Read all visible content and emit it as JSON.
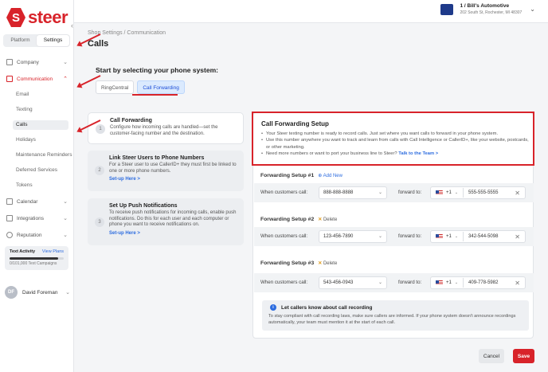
{
  "brand": {
    "name": "steer",
    "mark": "S"
  },
  "sidebar": {
    "segment": {
      "platform": "Platform",
      "settings": "Settings"
    },
    "nav": {
      "company": "Company",
      "communication": "Communication",
      "calendar": "Calendar",
      "integrations": "Integrations",
      "reputation": "Reputation"
    },
    "sub_items": {
      "email": "Email",
      "texting": "Texting",
      "calls": "Calls",
      "holidays": "Holidays",
      "maintenance": "Maintenance Reminders",
      "deferred": "Deferred Services",
      "tokens": "Tokens"
    },
    "text_activity": {
      "title": "Text Activity",
      "link": "View Plans",
      "caption": "0/101,000 Text Campaigns",
      "progress": 0.9
    },
    "user": {
      "initials": "DF",
      "name": "David Foreman"
    }
  },
  "header": {
    "account_title": "1 / Bill's Automotive",
    "account_address": "202 South St, Rochester, MI 48307"
  },
  "breadcrumb": "Shop Settings / Communication",
  "page_title": "Calls",
  "system": {
    "title": "Start by selecting your phone system:",
    "tabs": [
      "RingCentral",
      "Call Forwarding"
    ]
  },
  "steps": [
    {
      "num": "1",
      "title": "Call Forwarding",
      "desc": "Configure how incoming calls are handled—set the customer-facing number and the destination.",
      "link": ""
    },
    {
      "num": "2",
      "title": "Link Steer Users to Phone Numbers",
      "desc": "For a Steer user to use CallerID+ they must first be linked to one or more phone numbers.",
      "link": "Set-up Here >"
    },
    {
      "num": "3",
      "title": "Set Up Push Notifications",
      "desc": "To receive push notifications for incoming calls, enable push notifications. Do this for each user and each computer or phone you want to receive notifications on.",
      "link": "Set-up Here >"
    }
  ],
  "cf": {
    "title": "Call Forwarding Setup",
    "bullets": [
      "Your Steer texting number is ready to record calls. Just set where you want calls to forward in your phone system.",
      "Use this number anywhere you want to track and learn from calls with Call Intelligence or CallerID+, like your website, postcards, or other marketing."
    ],
    "bullet3_text": "Need more numbers or want to port your business line to Steer?",
    "bullet3_link": "Talk to the Team >",
    "when_label": "When customers call:",
    "forward_label": "forward to:",
    "country_code": "+1",
    "setups": [
      {
        "title": "Forwarding Setup #1",
        "action": "Add New",
        "from": "888-888-8888",
        "to": "555-555-5555"
      },
      {
        "title": "Forwarding Setup #2",
        "action": "Delete",
        "from": "123-456-7890",
        "to": "342-544-5098"
      },
      {
        "title": "Forwarding Setup #3",
        "action": "Delete",
        "from": "543-456-0943",
        "to": "409-778-5982"
      }
    ],
    "notice_title": "Let callers know about call recording",
    "notice_desc": "To stay compliant with call recording laws, make sure callers are informed. If your phone system doesn't announce recordings automatically, your team must mention it at the start of each call."
  },
  "buttons": {
    "cancel": "Cancel",
    "save": "Save"
  },
  "colors": {
    "accent": "#d8232a",
    "link": "#2d6cdf"
  }
}
